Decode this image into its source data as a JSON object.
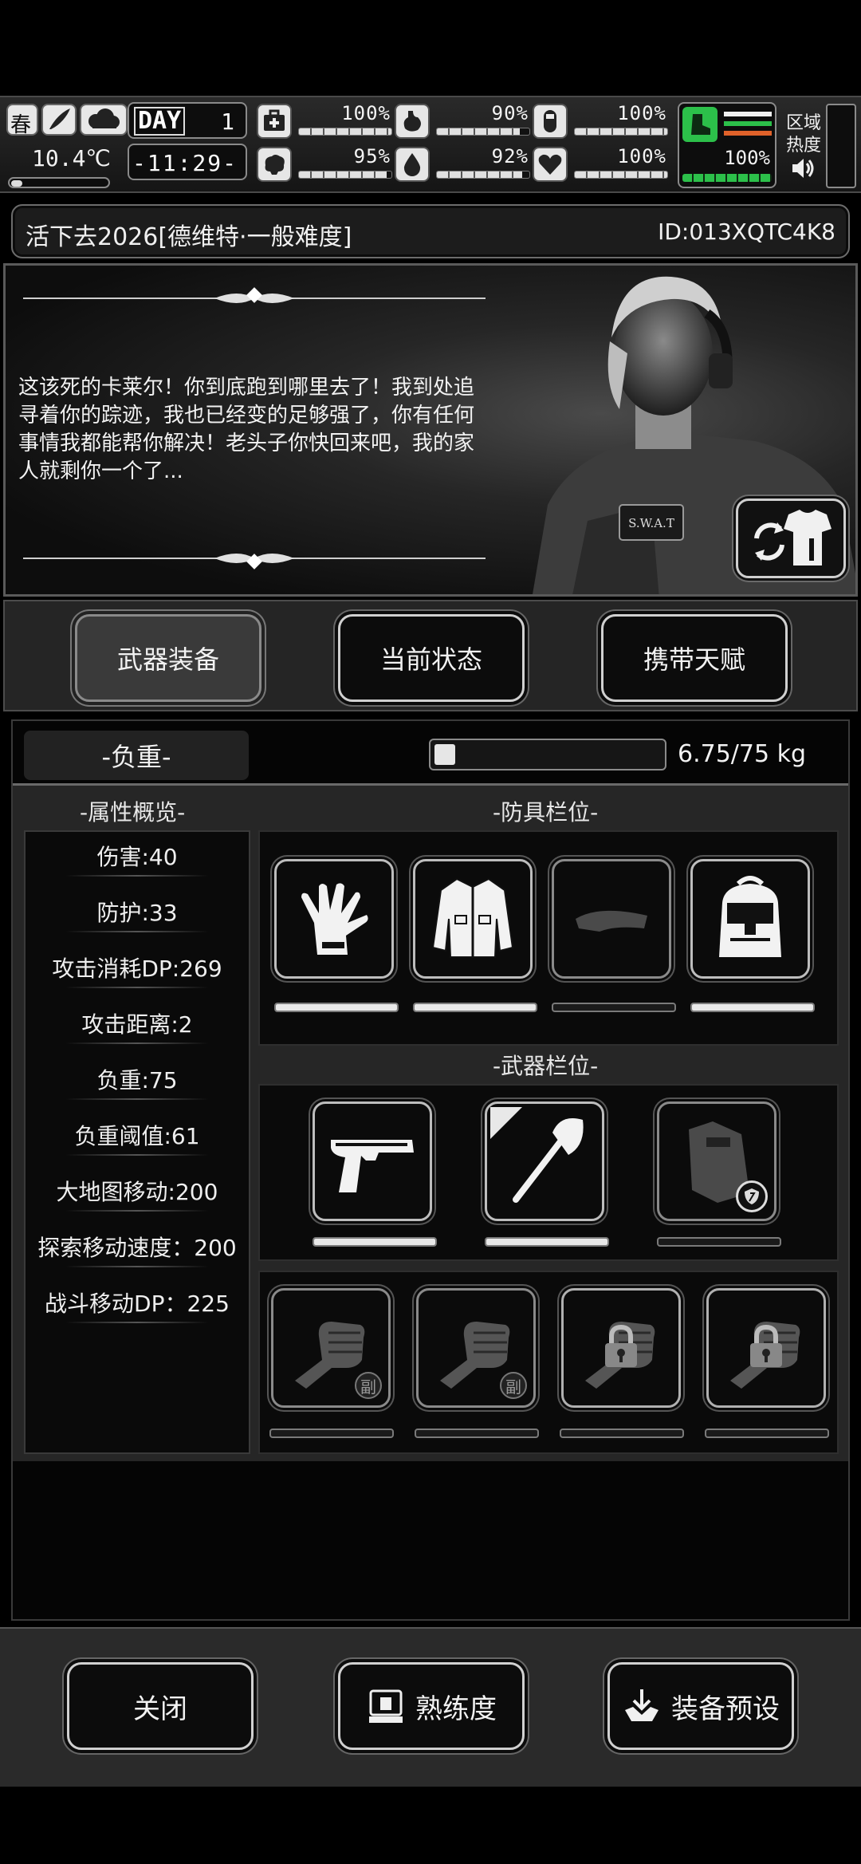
{
  "hud": {
    "season": "春",
    "temperature": "10.4℃",
    "day_label": "DAY",
    "day_number": "1",
    "clock": "-11:29-",
    "stats": [
      {
        "icon": "medkit-icon",
        "value": "100%",
        "level": 1.0
      },
      {
        "icon": "stomach-icon",
        "value": "90%",
        "level": 0.9
      },
      {
        "icon": "pill-icon",
        "value": "100%",
        "level": 1.0
      },
      {
        "icon": "brain-icon",
        "value": "95%",
        "level": 0.95
      },
      {
        "icon": "water-drop-icon",
        "value": "92%",
        "level": 0.92
      },
      {
        "icon": "heart-icon",
        "value": "100%",
        "level": 1.0
      }
    ],
    "stamina_value": "100%",
    "zone_label_1": "区域",
    "zone_label_2": "热度"
  },
  "title": {
    "game_title": "活下去2026[德维特·一般难度]",
    "player_id": "ID:013XQTC4K8"
  },
  "story": {
    "text": "这该死的卡莱尔！你到底跑到哪里去了！我到处追寻着你的踪迹，我也已经变的足够强了，你有任何事情我都能帮你解决！老头子你快回来吧，我的家人就剩你一个了...",
    "badge_text": "S.W.A.T"
  },
  "tabs": [
    {
      "label": "武器装备",
      "active": true
    },
    {
      "label": "当前状态",
      "active": false
    },
    {
      "label": "携带天赋",
      "active": false
    }
  ],
  "load": {
    "label": "-负重-",
    "text": "6.75/75 kg",
    "fraction": 0.09
  },
  "attributes": {
    "title": "-属性概览-",
    "items": [
      "伤害:40",
      "防护:33",
      "攻击消耗DP:269",
      "攻击距离:2",
      "负重:75",
      "负重阈值:61",
      "大地图移动:200",
      "探索移动速度：200",
      "战斗移动DP：225"
    ]
  },
  "armor": {
    "title": "-防具栏位-",
    "slots": [
      {
        "name": "glove-icon",
        "durability": 1.0
      },
      {
        "name": "jacket-icon",
        "durability": 1.0
      },
      {
        "name": "cap-icon",
        "durability": 0.0
      },
      {
        "name": "backpack-icon",
        "durability": 1.0
      }
    ]
  },
  "weapons": {
    "title": "-武器栏位-",
    "slots": [
      {
        "name": "pistol-icon",
        "durability": 1.0
      },
      {
        "name": "axe-icon",
        "durability": 1.0
      },
      {
        "name": "riot-shield-icon",
        "durability": 0.0
      }
    ],
    "sub_label": "副",
    "extra_slots": [
      {
        "name": "fist-icon",
        "state": "sub"
      },
      {
        "name": "fist-icon",
        "state": "sub"
      },
      {
        "name": "lock-icon",
        "state": "locked"
      },
      {
        "name": "lock-icon",
        "state": "locked"
      }
    ]
  },
  "footer": {
    "close_label": "关闭",
    "proficiency_label": "熟练度",
    "preset_label": "装备预设"
  }
}
